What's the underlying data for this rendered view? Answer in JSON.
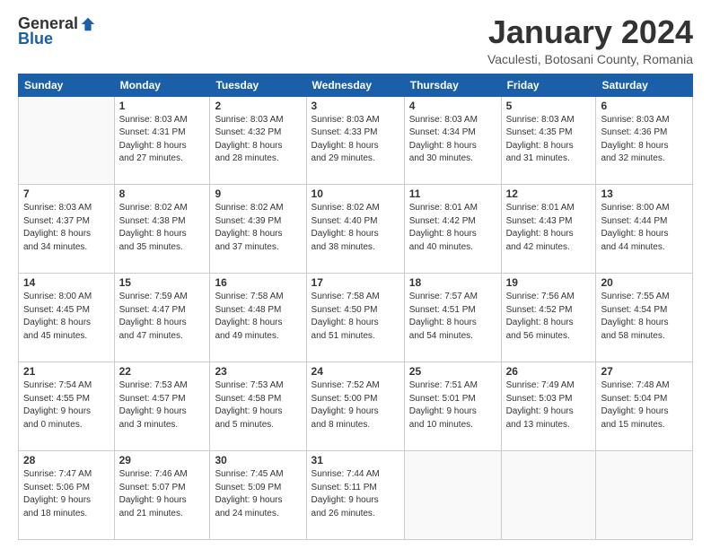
{
  "logo": {
    "general": "General",
    "blue": "Blue"
  },
  "header": {
    "month_year": "January 2024",
    "location": "Vaculesti, Botosani County, Romania"
  },
  "weekdays": [
    "Sunday",
    "Monday",
    "Tuesday",
    "Wednesday",
    "Thursday",
    "Friday",
    "Saturday"
  ],
  "weeks": [
    [
      {
        "day": "",
        "info": ""
      },
      {
        "day": "1",
        "info": "Sunrise: 8:03 AM\nSunset: 4:31 PM\nDaylight: 8 hours\nand 27 minutes."
      },
      {
        "day": "2",
        "info": "Sunrise: 8:03 AM\nSunset: 4:32 PM\nDaylight: 8 hours\nand 28 minutes."
      },
      {
        "day": "3",
        "info": "Sunrise: 8:03 AM\nSunset: 4:33 PM\nDaylight: 8 hours\nand 29 minutes."
      },
      {
        "day": "4",
        "info": "Sunrise: 8:03 AM\nSunset: 4:34 PM\nDaylight: 8 hours\nand 30 minutes."
      },
      {
        "day": "5",
        "info": "Sunrise: 8:03 AM\nSunset: 4:35 PM\nDaylight: 8 hours\nand 31 minutes."
      },
      {
        "day": "6",
        "info": "Sunrise: 8:03 AM\nSunset: 4:36 PM\nDaylight: 8 hours\nand 32 minutes."
      }
    ],
    [
      {
        "day": "7",
        "info": ""
      },
      {
        "day": "8",
        "info": "Sunrise: 8:02 AM\nSunset: 4:38 PM\nDaylight: 8 hours\nand 35 minutes."
      },
      {
        "day": "9",
        "info": "Sunrise: 8:02 AM\nSunset: 4:39 PM\nDaylight: 8 hours\nand 37 minutes."
      },
      {
        "day": "10",
        "info": "Sunrise: 8:02 AM\nSunset: 4:40 PM\nDaylight: 8 hours\nand 38 minutes."
      },
      {
        "day": "11",
        "info": "Sunrise: 8:01 AM\nSunset: 4:42 PM\nDaylight: 8 hours\nand 40 minutes."
      },
      {
        "day": "12",
        "info": "Sunrise: 8:01 AM\nSunset: 4:43 PM\nDaylight: 8 hours\nand 42 minutes."
      },
      {
        "day": "13",
        "info": "Sunrise: 8:00 AM\nSunset: 4:44 PM\nDaylight: 8 hours\nand 44 minutes."
      }
    ],
    [
      {
        "day": "14",
        "info": "Sunrise: 8:00 AM\nSunset: 4:45 PM\nDaylight: 8 hours\nand 45 minutes."
      },
      {
        "day": "15",
        "info": "Sunrise: 7:59 AM\nSunset: 4:47 PM\nDaylight: 8 hours\nand 47 minutes."
      },
      {
        "day": "16",
        "info": "Sunrise: 7:58 AM\nSunset: 4:48 PM\nDaylight: 8 hours\nand 49 minutes."
      },
      {
        "day": "17",
        "info": "Sunrise: 7:58 AM\nSunset: 4:50 PM\nDaylight: 8 hours\nand 51 minutes."
      },
      {
        "day": "18",
        "info": "Sunrise: 7:57 AM\nSunset: 4:51 PM\nDaylight: 8 hours\nand 54 minutes."
      },
      {
        "day": "19",
        "info": "Sunrise: 7:56 AM\nSunset: 4:52 PM\nDaylight: 8 hours\nand 56 minutes."
      },
      {
        "day": "20",
        "info": "Sunrise: 7:55 AM\nSunset: 4:54 PM\nDaylight: 8 hours\nand 58 minutes."
      }
    ],
    [
      {
        "day": "21",
        "info": "Sunrise: 7:54 AM\nSunset: 4:55 PM\nDaylight: 9 hours\nand 0 minutes."
      },
      {
        "day": "22",
        "info": "Sunrise: 7:53 AM\nSunset: 4:57 PM\nDaylight: 9 hours\nand 3 minutes."
      },
      {
        "day": "23",
        "info": "Sunrise: 7:53 AM\nSunset: 4:58 PM\nDaylight: 9 hours\nand 5 minutes."
      },
      {
        "day": "24",
        "info": "Sunrise: 7:52 AM\nSunset: 5:00 PM\nDaylight: 9 hours\nand 8 minutes."
      },
      {
        "day": "25",
        "info": "Sunrise: 7:51 AM\nSunset: 5:01 PM\nDaylight: 9 hours\nand 10 minutes."
      },
      {
        "day": "26",
        "info": "Sunrise: 7:49 AM\nSunset: 5:03 PM\nDaylight: 9 hours\nand 13 minutes."
      },
      {
        "day": "27",
        "info": "Sunrise: 7:48 AM\nSunset: 5:04 PM\nDaylight: 9 hours\nand 15 minutes."
      }
    ],
    [
      {
        "day": "28",
        "info": "Sunrise: 7:47 AM\nSunset: 5:06 PM\nDaylight: 9 hours\nand 18 minutes."
      },
      {
        "day": "29",
        "info": "Sunrise: 7:46 AM\nSunset: 5:07 PM\nDaylight: 9 hours\nand 21 minutes."
      },
      {
        "day": "30",
        "info": "Sunrise: 7:45 AM\nSunset: 5:09 PM\nDaylight: 9 hours\nand 24 minutes."
      },
      {
        "day": "31",
        "info": "Sunrise: 7:44 AM\nSunset: 5:11 PM\nDaylight: 9 hours\nand 26 minutes."
      },
      {
        "day": "",
        "info": ""
      },
      {
        "day": "",
        "info": ""
      },
      {
        "day": "",
        "info": ""
      }
    ]
  ]
}
